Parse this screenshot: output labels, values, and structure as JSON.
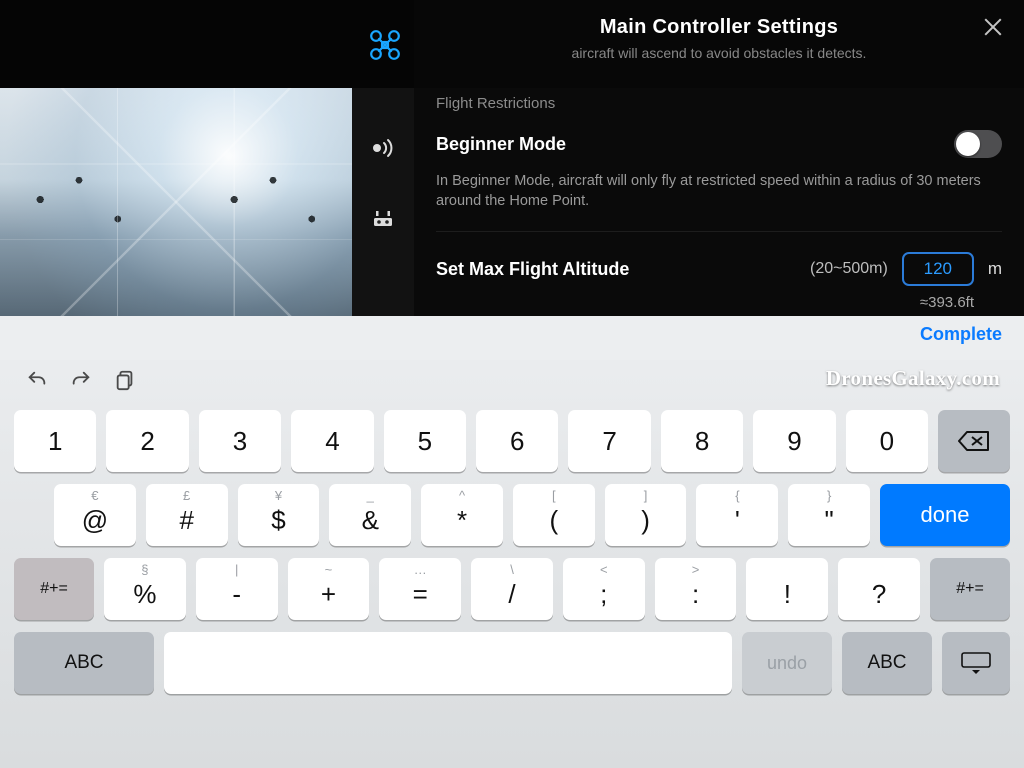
{
  "panel": {
    "title": "Main Controller Settings",
    "clipped_hint": "aircraft will ascend to avoid obstacles it detects.",
    "section_label": "Flight Restrictions",
    "beginner_mode": {
      "label": "Beginner Mode",
      "description": "In Beginner Mode, aircraft will only fly at restricted speed within a radius of 30 meters around the Home Point.",
      "enabled": false
    },
    "max_altitude": {
      "label": "Set Max Flight Altitude",
      "range": "(20~500m)",
      "value": "120",
      "unit": "m",
      "feet": "≈393.6ft"
    }
  },
  "toolbar": {
    "complete": "Complete",
    "watermark": "DronesGalaxy.com"
  },
  "keyboard": {
    "row1": [
      "1",
      "2",
      "3",
      "4",
      "5",
      "6",
      "7",
      "8",
      "9",
      "0"
    ],
    "row2": [
      {
        "p": "@",
        "s": "€"
      },
      {
        "p": "#",
        "s": "£"
      },
      {
        "p": "$",
        "s": "¥"
      },
      {
        "p": "&",
        "s": "_"
      },
      {
        "p": "*",
        "s": "^"
      },
      {
        "p": "(",
        "s": "["
      },
      {
        "p": ")",
        "s": "]"
      },
      {
        "p": "'",
        "s": "{"
      },
      {
        "p": "\"",
        "s": "}"
      }
    ],
    "done": "done",
    "shift": "#+=",
    "row3": [
      {
        "p": "%",
        "s": "§"
      },
      {
        "p": "-",
        "s": "|"
      },
      {
        "p": "+",
        "s": "~"
      },
      {
        "p": "=",
        "s": "…"
      },
      {
        "p": "/",
        "s": "\\"
      },
      {
        "p": ";",
        "s": "<"
      },
      {
        "p": ":",
        "s": ">"
      },
      {
        "p": "!",
        "s": ""
      },
      {
        "p": "?",
        "s": ""
      }
    ],
    "abc": "ABC",
    "undo": "undo"
  }
}
